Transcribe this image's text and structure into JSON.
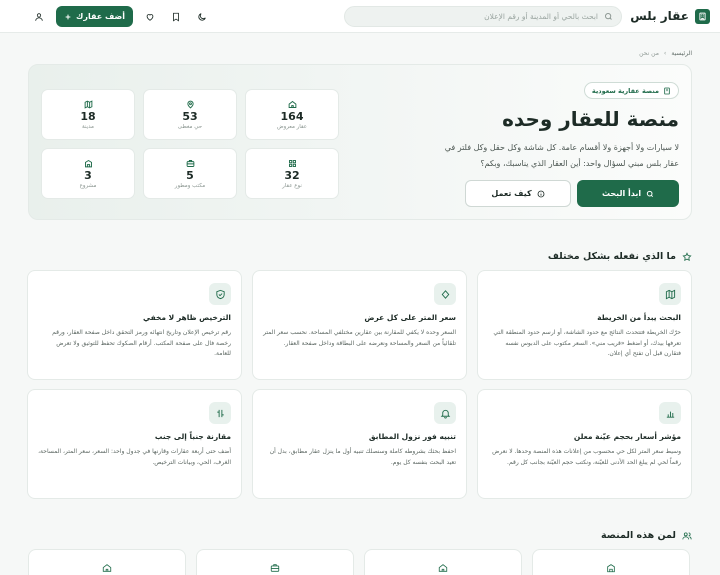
{
  "header": {
    "brand_name": "عقار بلس",
    "search_placeholder": "ابحث بالحي أو المدينة أو رقم الإعلان",
    "add_button_label": "أضف عقارك"
  },
  "breadcrumb": {
    "home": "الرئيسية",
    "separator": "›",
    "current": "من نحن"
  },
  "hero": {
    "badge": "منصة عقارية سعودية",
    "title": "منصة للعقار وحده",
    "description": "لا سيارات ولا أجهزة ولا أقسام عامة. كل شاشة وكل حقل وكل فلتر في عقار بلس مبني لسؤال واحد: أين العقار الذي يناسبك، وبكم؟",
    "primary_button": "ابدأ البحث",
    "secondary_button": "كيف تعمل"
  },
  "stats": [
    {
      "icon": "map-icon",
      "value": "18",
      "label": "مدينة"
    },
    {
      "icon": "map-pin-icon",
      "value": "53",
      "label": "حي مغطى"
    },
    {
      "icon": "home-icon",
      "value": "164",
      "label": "عقار معروض"
    },
    {
      "icon": "building-icon",
      "value": "3",
      "label": "مشروع"
    },
    {
      "icon": "briefcase-icon",
      "value": "5",
      "label": "مكتب ومطور"
    },
    {
      "icon": "grid-icon",
      "value": "32",
      "label": "نوع عقار"
    }
  ],
  "features_section": {
    "title": "ما الذي نفعله بشكل مختلف"
  },
  "features": [
    {
      "icon": "map-icon",
      "title": "البحث يبدأ من الخريطة",
      "desc": "حرّك الخريطة فتتحدث النتائج مع حدود الشاشة، أو ارسم حدود المنطقة التي تعرفها بيدك، أو اضغط «قريب مني». السعر مكتوب على الدبوس نفسه فتقارن قبل أن تفتح أي إعلان."
    },
    {
      "icon": "diamond-icon",
      "title": "سعر المتر على كل عرض",
      "desc": "السعر وحده لا يكفي للمقارنة بين عقارين مختلفي المساحة. نحسب سعر المتر تلقائياً من السعر والمساحة ونعرضه على البطاقة وداخل صفحة العقار."
    },
    {
      "icon": "shield-check-icon",
      "title": "الترخيص ظاهر لا مخفي",
      "desc": "رقم ترخيص الإعلان وتاريخ انتهائه ورمز التحقق داخل صفحة العقار، ورقم رخصة فال على صفحة المكتب. أرقام الصكوك تحفظ للتوثيق ولا تعرض للعامة."
    },
    {
      "icon": "bar-chart-icon",
      "title": "مؤشر أسعار بحجم عيّنة معلن",
      "desc": "وسيط سعر المتر لكل حي محسوب من إعلانات هذه المنصة وحدها. لا نعرض رقماً لحي لم يبلغ الحد الأدنى للعيّنة، ونكتب حجم العيّنة بجانب كل رقم."
    },
    {
      "icon": "bell-icon",
      "title": "تنبيه فور نزول المطابق",
      "desc": "احفظ بحثك بشروطه كاملة وسنصلك تنبيه أول ما ينزل عقار مطابق، بدل أن تعيد البحث بنفسه كل يوم."
    },
    {
      "icon": "compare-icon",
      "title": "مقارنة جنباً إلى جنب",
      "desc": "أضف حتى أربعة عقارات وقارنها في جدول واحد: السعر، سعر المتر، المساحة، الغرف، الحي، وبيانات الترخيص."
    }
  ],
  "audience_section": {
    "title": "لمن هذه المنصة"
  },
  "audience_cards": [
    {
      "icon": "home-icon"
    },
    {
      "icon": "briefcase-icon"
    },
    {
      "icon": "home-icon"
    },
    {
      "icon": "building-icon"
    }
  ],
  "colors": {
    "accent": "#1f6b4a",
    "accent_light": "#e8f1ed",
    "background": "#f6f8f7"
  }
}
